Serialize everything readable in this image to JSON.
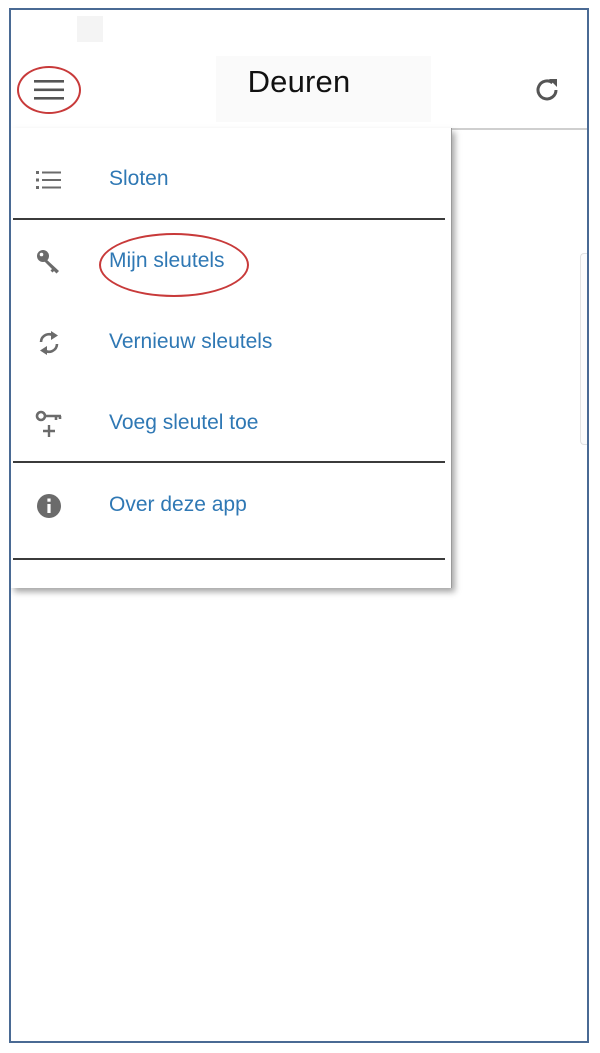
{
  "appbar": {
    "title": "Deuren"
  },
  "icons": {
    "menu": "menu-icon",
    "refresh": "refresh-icon"
  },
  "colors": {
    "link": "#2f78b4",
    "annotation": "#c83a3a",
    "icon": "#6b6b6b"
  },
  "drawer": {
    "items": [
      {
        "label": "Sloten",
        "icon": "list-icon"
      },
      {
        "label": "Mijn sleutels",
        "icon": "key-icon"
      },
      {
        "label": "Vernieuw sleutels",
        "icon": "sync-icon"
      },
      {
        "label": "Voeg sleutel toe",
        "icon": "add-key-icon"
      },
      {
        "label": "Over deze app",
        "icon": "info-icon"
      }
    ]
  }
}
